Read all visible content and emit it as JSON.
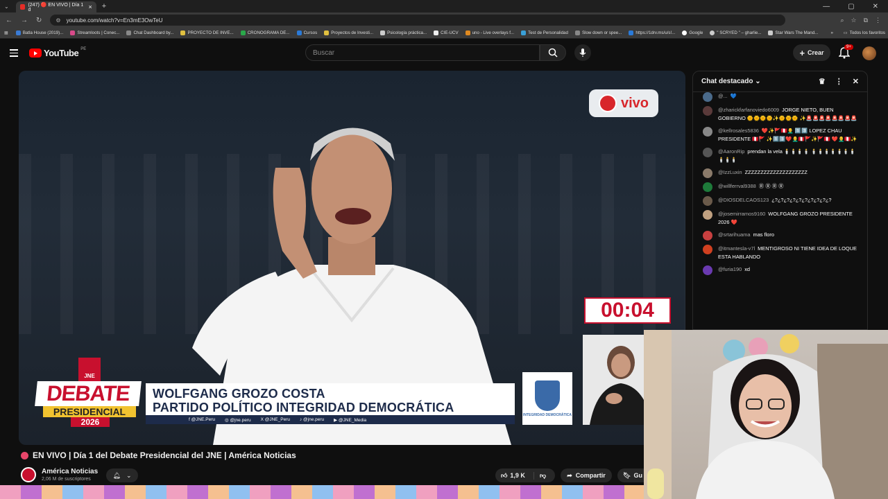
{
  "browser": {
    "tab_title": "(247) 🔴 EN VIVO | Día 1 d",
    "new_tab": "+",
    "url": "youtube.com/watch?v=En3mE3OwTeU",
    "bookmarks": [
      "Batla House (2019)...",
      "Streamloots | Conec...",
      "Chat Dashboard by...",
      "PROYECTO DE INVE...",
      "CRONOGRAMA DE...",
      "Cursos",
      "Proyectos de Investi...",
      "Psicología práctica...",
      "CIE-UCV",
      "uno - Live overlays f...",
      "Test de Personalidad",
      "Slow down or spee...",
      "https://1drv.ms/u/s!...",
      "Google",
      "\" SCRYED \" – gharlie...",
      "Star Wars The Mand..."
    ],
    "bookmarks_more": "»",
    "all_favorites": "Todos los favoritos"
  },
  "youtube": {
    "logo": "YouTube",
    "country": "PE",
    "search_placeholder": "Buscar",
    "create": "Crear",
    "notif_badge": "9+"
  },
  "player": {
    "live_label": "vivo",
    "timer": "00:04",
    "jne": "JNE",
    "debate_word": "DEBATE",
    "presidential": "PRESIDENCIAL",
    "year": "2026",
    "candidate": "WOLFGANG GROZO COSTA",
    "party": "PARTIDO POLÍTICO INTEGRIDAD DEMOCRÁTICA",
    "socials": [
      "f @JNE.Peru",
      "◎ @jne.peru",
      "X @JNE_Peru",
      "♪ @jne.peru",
      "▶ @JNE_Media"
    ],
    "party_logo_label": "INTEGRIDAD DEMOCRÁTICA"
  },
  "video": {
    "title": "EN VIVO | Día 1 del Debate Presidencial del JNE | América Noticias",
    "channel": "América Noticias",
    "subscribers": "2,06 M de suscriptores",
    "likes": "1,9 K",
    "share": "Compartir",
    "save": "Gu"
  },
  "chat": {
    "header": "Chat destacado",
    "messages": [
      {
        "author": "@...",
        "text": "💙",
        "color": "#4a6a8a"
      },
      {
        "author": "@zharickfarfanoviedo6009",
        "text": "JORGE NIETO, BUEN GOBIERNO 🌞🌞🌞🌞✨🌞🌞🌞 ✨🚨🚨🚨🚨🚨🚨🚨🚨",
        "color": "#5a3a3a"
      },
      {
        "author": "@kellrosales5836",
        "text": "❤️✨🚩🇵🇪👨‍🦲 1️⃣3️⃣ LOPEZ CHAU PRESIDENTE 🇵🇪🚩 ✨1️⃣3️⃣❤️👨‍🦲🇵🇪🚩✨🚩🇵🇪 ❤️👨‍🦲🇵🇪✨",
        "color": "#888"
      },
      {
        "author": "@AaronRip",
        "text": "prendan la vela 🕯️🕯️🕯️🕯️ 🕯️🕯️🕯️🕯️🕯️🕯️🕯️🕯️🕯️🕯️",
        "color": "#555"
      },
      {
        "author": "@IzzLuxin",
        "text": "ZZZZZZZZZZZZZZZZZZZZ",
        "color": "#8a7a6a"
      },
      {
        "author": "@willferrval9388",
        "text": "Ⓡ Ⓡ Ⓡ Ⓡ",
        "color": "#1e7a3a"
      },
      {
        "author": "@DIOSDELCAOS123",
        "text": "¿?¿?¿?¿?¿?¿?¿?¿?¿?¿?",
        "color": "#6a5a4a"
      },
      {
        "author": "@josemirramos9160",
        "text": "WOLFGANG GROZO PRESIDENTE 2026 ❤️",
        "color": "#c0a080"
      },
      {
        "author": "@srtarihuama",
        "text": "mas floro",
        "color": "#c84040"
      },
      {
        "author": "@itmantesla-v7l",
        "text": "MENTIGROSO NI TIENE IDEA DE LOQUE ESTA HABLANDO",
        "color": "#d04020"
      },
      {
        "author": "@furia190",
        "text": "xd",
        "color": "#6a3ab0"
      }
    ]
  }
}
